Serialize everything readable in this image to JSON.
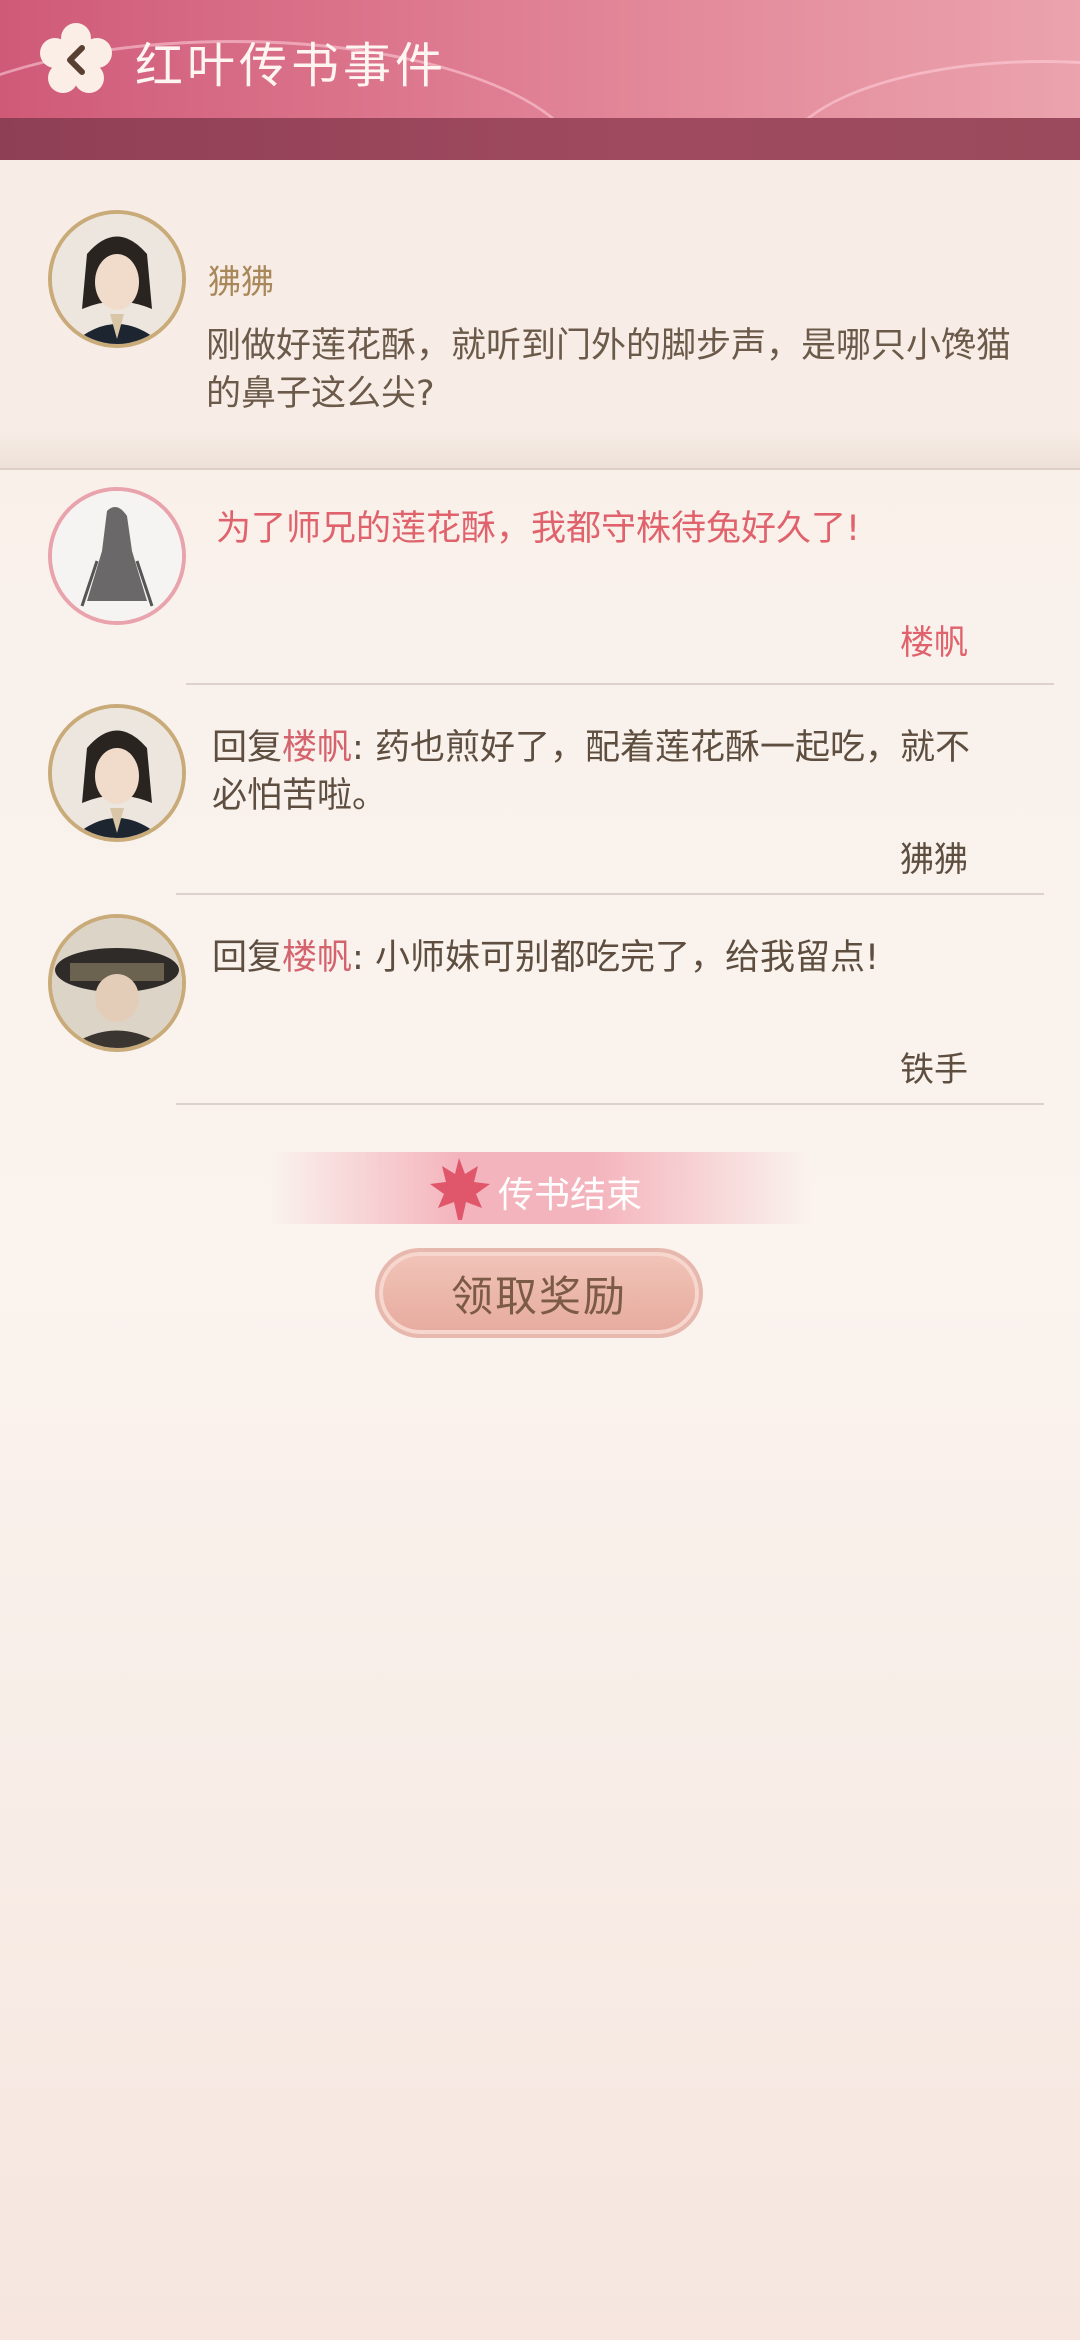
{
  "header": {
    "title": "红叶传书事件"
  },
  "post": {
    "name": "狒狒",
    "text": "刚做好莲花酥，就听到门外的脚步声，是哪只小馋猫的鼻子这么尖?"
  },
  "comments": [
    {
      "text": "为了师兄的莲花酥，我都守株待兔好久了!",
      "author": "楼帆"
    },
    {
      "reply_prefix": "回复",
      "reply_to": "楼帆",
      "text": ": 药也煎好了，配着莲花酥一起吃，就不必怕苦啦。",
      "author": "狒狒"
    },
    {
      "reply_prefix": "回复",
      "reply_to": "楼帆",
      "text": ": 小师妹可别都吃完了，给我留点!",
      "author": "铁手"
    }
  ],
  "end_label": "传书结束",
  "reward_button": "领取奖励"
}
